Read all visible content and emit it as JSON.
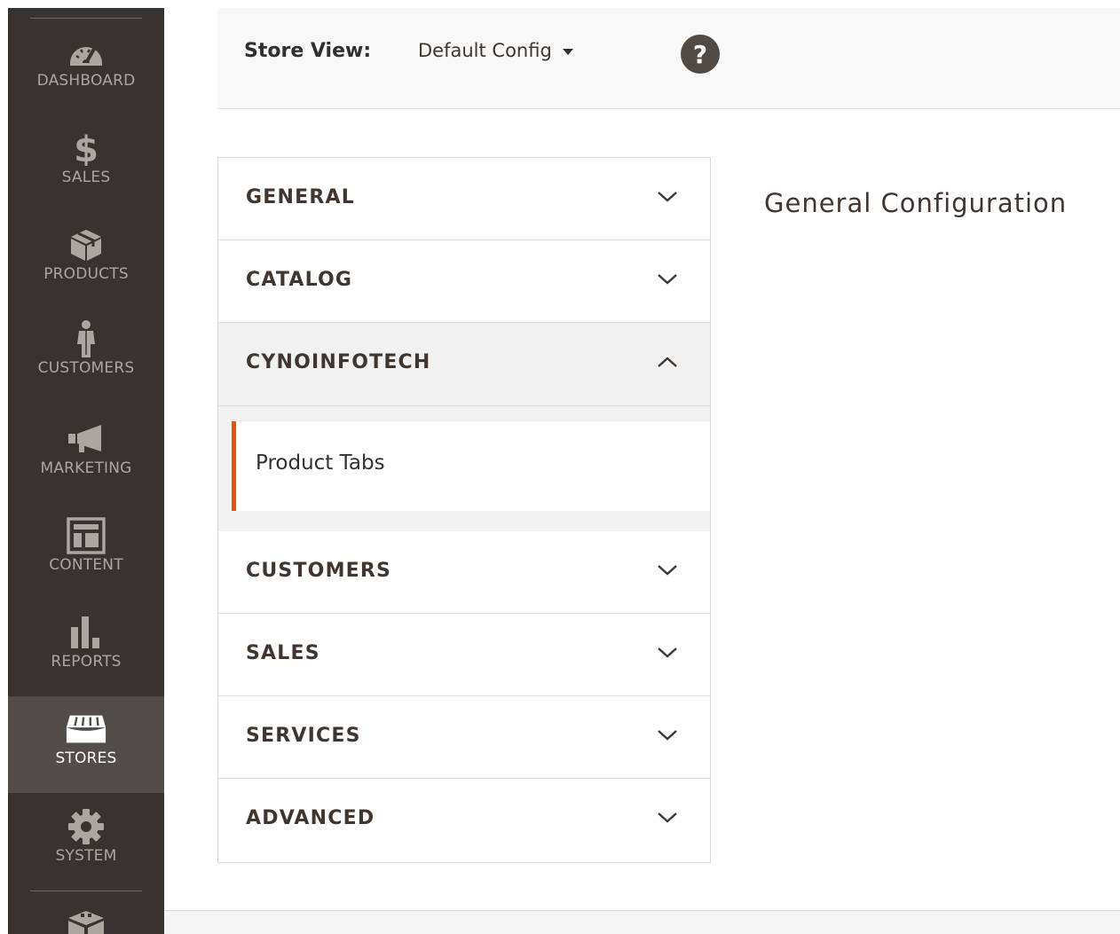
{
  "nav": {
    "items": [
      {
        "label": "DASHBOARD",
        "icon": "dashboard-icon"
      },
      {
        "label": "SALES",
        "icon": "dollar-icon"
      },
      {
        "label": "PRODUCTS",
        "icon": "box-icon"
      },
      {
        "label": "CUSTOMERS",
        "icon": "person-icon"
      },
      {
        "label": "MARKETING",
        "icon": "megaphone-icon"
      },
      {
        "label": "CONTENT",
        "icon": "layout-icon"
      },
      {
        "label": "REPORTS",
        "icon": "bar-chart-icon"
      },
      {
        "label": "STORES",
        "icon": "storefront-icon"
      },
      {
        "label": "SYSTEM",
        "icon": "gear-icon"
      }
    ],
    "active": "STORES",
    "colors": {
      "background": "#373330",
      "active_background": "#524d49",
      "label": "#aaa6a0"
    }
  },
  "store_bar": {
    "label": "Store View:",
    "selected": "Default Config",
    "help": "?"
  },
  "tabs": [
    {
      "title": "GENERAL",
      "state": "collapsed"
    },
    {
      "title": "CATALOG",
      "state": "collapsed"
    },
    {
      "title": "CYNOINFOTECH",
      "state": "expanded",
      "items": [
        "Product Tabs"
      ]
    },
    {
      "title": "CUSTOMERS",
      "state": "collapsed"
    },
    {
      "title": "SALES",
      "state": "collapsed"
    },
    {
      "title": "SERVICES",
      "state": "collapsed"
    },
    {
      "title": "ADVANCED",
      "state": "collapsed"
    }
  ],
  "content": {
    "title": "General Configuration"
  },
  "colors": {
    "accent": "#eb5202",
    "help_button": "#514943"
  }
}
